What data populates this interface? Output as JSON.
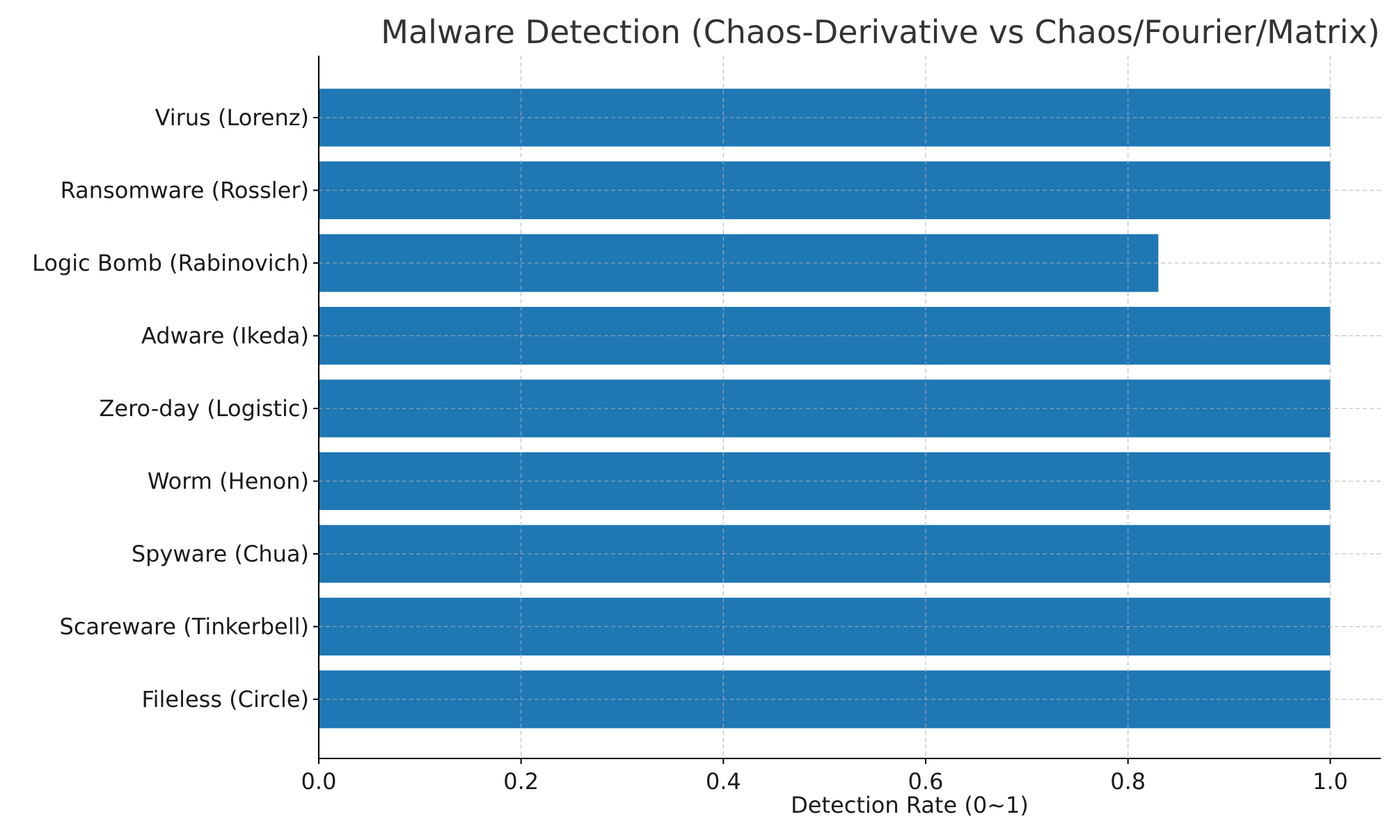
{
  "chart_data": {
    "type": "bar",
    "orientation": "horizontal",
    "title": "Malware Detection (Chaos-Derivative vs Chaos/Fourier/Matrix)",
    "xlabel": "Detection Rate (0~1)",
    "ylabel": "",
    "categories": [
      "Virus (Lorenz)",
      "Ransomware (Rossler)",
      "Logic Bomb (Rabinovich)",
      "Adware (Ikeda)",
      "Zero-day (Logistic)",
      "Worm (Henon)",
      "Spyware (Chua)",
      "Scareware (Tinkerbell)",
      "Fileless (Circle)"
    ],
    "values": [
      1.0,
      1.0,
      0.83,
      1.0,
      1.0,
      1.0,
      1.0,
      1.0,
      1.0
    ],
    "xlim": [
      0.0,
      1.05
    ],
    "xticks": [
      0.0,
      0.2,
      0.4,
      0.6,
      0.8,
      1.0
    ],
    "xtick_labels": [
      "0.0",
      "0.2",
      "0.4",
      "0.6",
      "0.8",
      "1.0"
    ],
    "grid": true,
    "bar_color": "#1f77b4",
    "grid_color": "#b0b0b0"
  }
}
